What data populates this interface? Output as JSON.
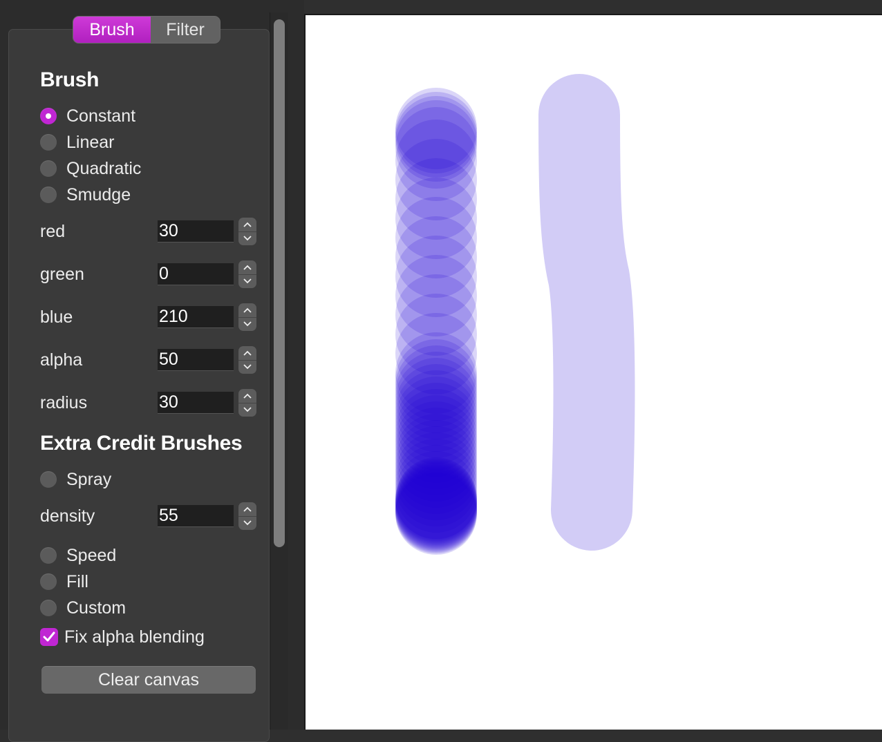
{
  "tabs": [
    {
      "label": "Brush",
      "active": true
    },
    {
      "label": "Filter",
      "active": false
    }
  ],
  "brush_section": {
    "title": "Brush",
    "options": [
      {
        "label": "Constant",
        "selected": true
      },
      {
        "label": "Linear",
        "selected": false
      },
      {
        "label": "Quadratic",
        "selected": false
      },
      {
        "label": "Smudge",
        "selected": false
      }
    ]
  },
  "fields": {
    "red": {
      "label": "red",
      "value": "30"
    },
    "green": {
      "label": "green",
      "value": "0"
    },
    "blue": {
      "label": "blue",
      "value": "210"
    },
    "alpha": {
      "label": "alpha",
      "value": "50"
    },
    "radius": {
      "label": "radius",
      "value": "30"
    },
    "density": {
      "label": "density",
      "value": "55"
    }
  },
  "extra_section": {
    "title": "Extra Credit Brushes",
    "spray": {
      "label": "Spray",
      "selected": false
    },
    "options": [
      {
        "label": "Speed",
        "selected": false
      },
      {
        "label": "Fill",
        "selected": false
      },
      {
        "label": "Custom",
        "selected": false
      }
    ]
  },
  "fix_alpha": {
    "label": "Fix alpha blending",
    "checked": true
  },
  "clear_button": {
    "label": "Clear canvas"
  },
  "colors": {
    "accent": "#c026d3",
    "panel": "#3a3a3a",
    "canvas": "#ffffff",
    "brush_stroke": "#1e00d2"
  }
}
